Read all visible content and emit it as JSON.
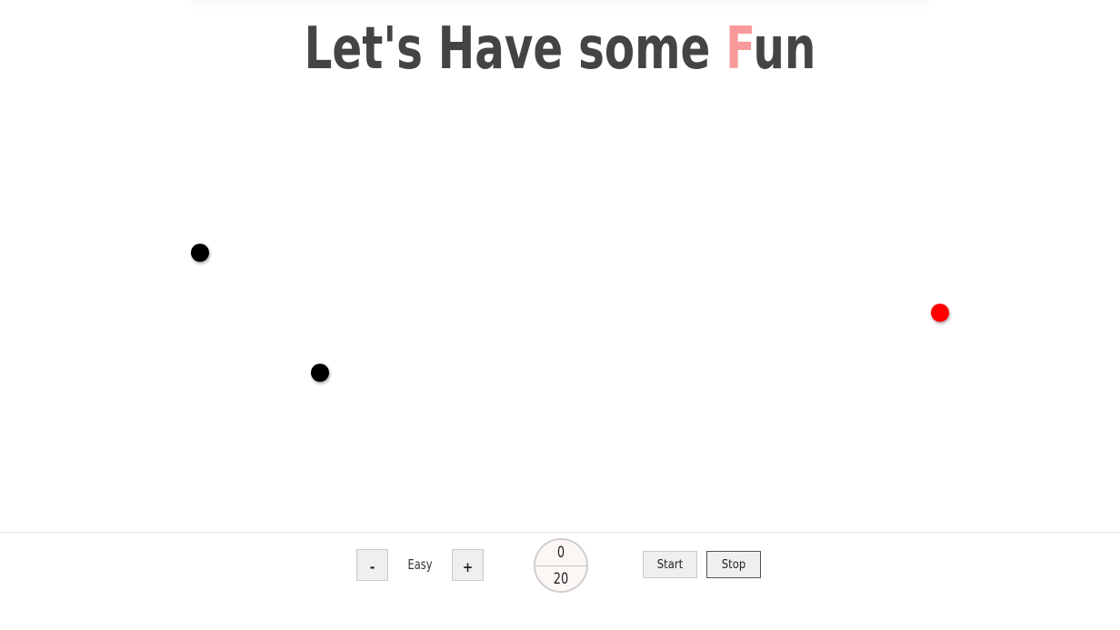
{
  "title": {
    "before": "Let's Have some ",
    "accent": "F",
    "after": "un"
  },
  "balls": [
    {
      "kind": "target",
      "color": "#000000"
    },
    {
      "kind": "target",
      "color": "#000000"
    },
    {
      "kind": "player",
      "color": "#ff0000"
    }
  ],
  "controls": {
    "decrease_label": "-",
    "increase_label": "+",
    "level": "Easy",
    "start_label": "Start",
    "stop_label": "Stop"
  },
  "score": {
    "current": "0",
    "target": "20"
  },
  "colors": {
    "title": "#444444",
    "accent": "#f99a9a",
    "player_ball": "#ff0000",
    "target_ball": "#000000"
  }
}
